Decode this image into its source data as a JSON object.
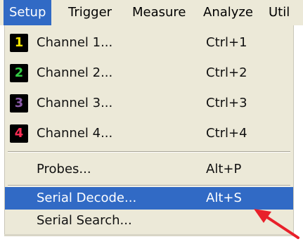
{
  "menubar": {
    "items": [
      {
        "label": "Setup"
      },
      {
        "label": "Trigger"
      },
      {
        "label": "Measure"
      },
      {
        "label": "Analyze"
      },
      {
        "label": "Util"
      }
    ]
  },
  "menu": {
    "channels": [
      {
        "badge": "1",
        "label": "Channel 1...",
        "shortcut": "Ctrl+1",
        "color": "#f5e400"
      },
      {
        "badge": "2",
        "label": "Channel 2...",
        "shortcut": "Ctrl+2",
        "color": "#33cc44"
      },
      {
        "badge": "3",
        "label": "Channel 3...",
        "shortcut": "Ctrl+3",
        "color": "#8a5aa8"
      },
      {
        "badge": "4",
        "label": "Channel 4...",
        "shortcut": "Ctrl+4",
        "color": "#ff2d55"
      }
    ],
    "probes": {
      "label": "Probes...",
      "shortcut": "Alt+P"
    },
    "serial_decode": {
      "label": "Serial Decode...",
      "shortcut": "Alt+S"
    },
    "serial_search": {
      "label": "Serial Search..."
    }
  },
  "colors": {
    "highlight": "#316ac5",
    "menu_bg": "#ece9d8",
    "annotation_arrow": "#e8202a"
  }
}
